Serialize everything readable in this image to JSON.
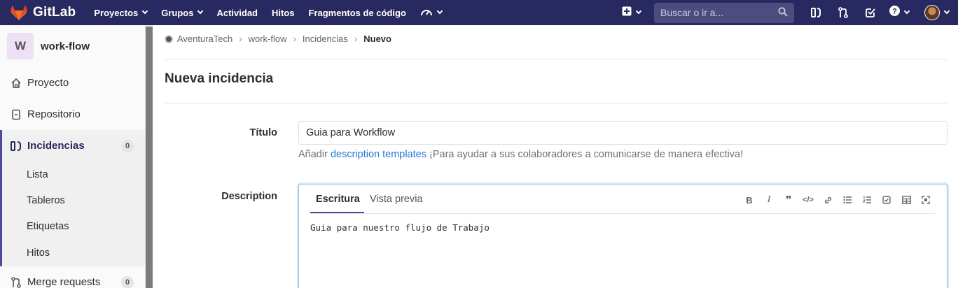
{
  "navbar": {
    "brand": "GitLab",
    "links": [
      "Proyectos",
      "Grupos",
      "Actividad",
      "Hitos",
      "Fragmentos de código"
    ],
    "search_placeholder": "Buscar o ir a...",
    "icons": [
      "plus-icon",
      "sidebar-toggle-icon",
      "merge-request-icon",
      "todo-check-icon",
      "help-icon",
      "user-avatar"
    ]
  },
  "sidebar": {
    "project_initial": "W",
    "project_name": "work-flow",
    "items": [
      {
        "label": "Proyecto",
        "icon": "home-icon"
      },
      {
        "label": "Repositorio",
        "icon": "repository-icon"
      },
      {
        "label": "Incidencias",
        "icon": "issues-icon",
        "badge": "0"
      },
      {
        "label": "Merge requests",
        "icon": "merge-request-icon",
        "badge": "0"
      }
    ],
    "sub_items": [
      "Lista",
      "Tableros",
      "Etiquetas",
      "Hitos"
    ]
  },
  "breadcrumb": [
    "AventuraTech",
    "work-flow",
    "Incidencias",
    "Nuevo"
  ],
  "page": {
    "title": "Nueva incidencia",
    "title_label": "Título",
    "title_value": "Guia para Workflow",
    "hint_prefix": "Añadir",
    "hint_link": "description templates",
    "hint_suffix": "¡Para ayudar a sus colaboradores a comunicarse de manera efectiva!",
    "description_label": "Description",
    "tabs": [
      "Escritura",
      "Vista previa"
    ],
    "description_value": "Guia para nuestro flujo de Trabajo"
  },
  "colors": {
    "navbar": "#292961",
    "accent": "#4b4ba3",
    "link": "#1f78d1"
  }
}
